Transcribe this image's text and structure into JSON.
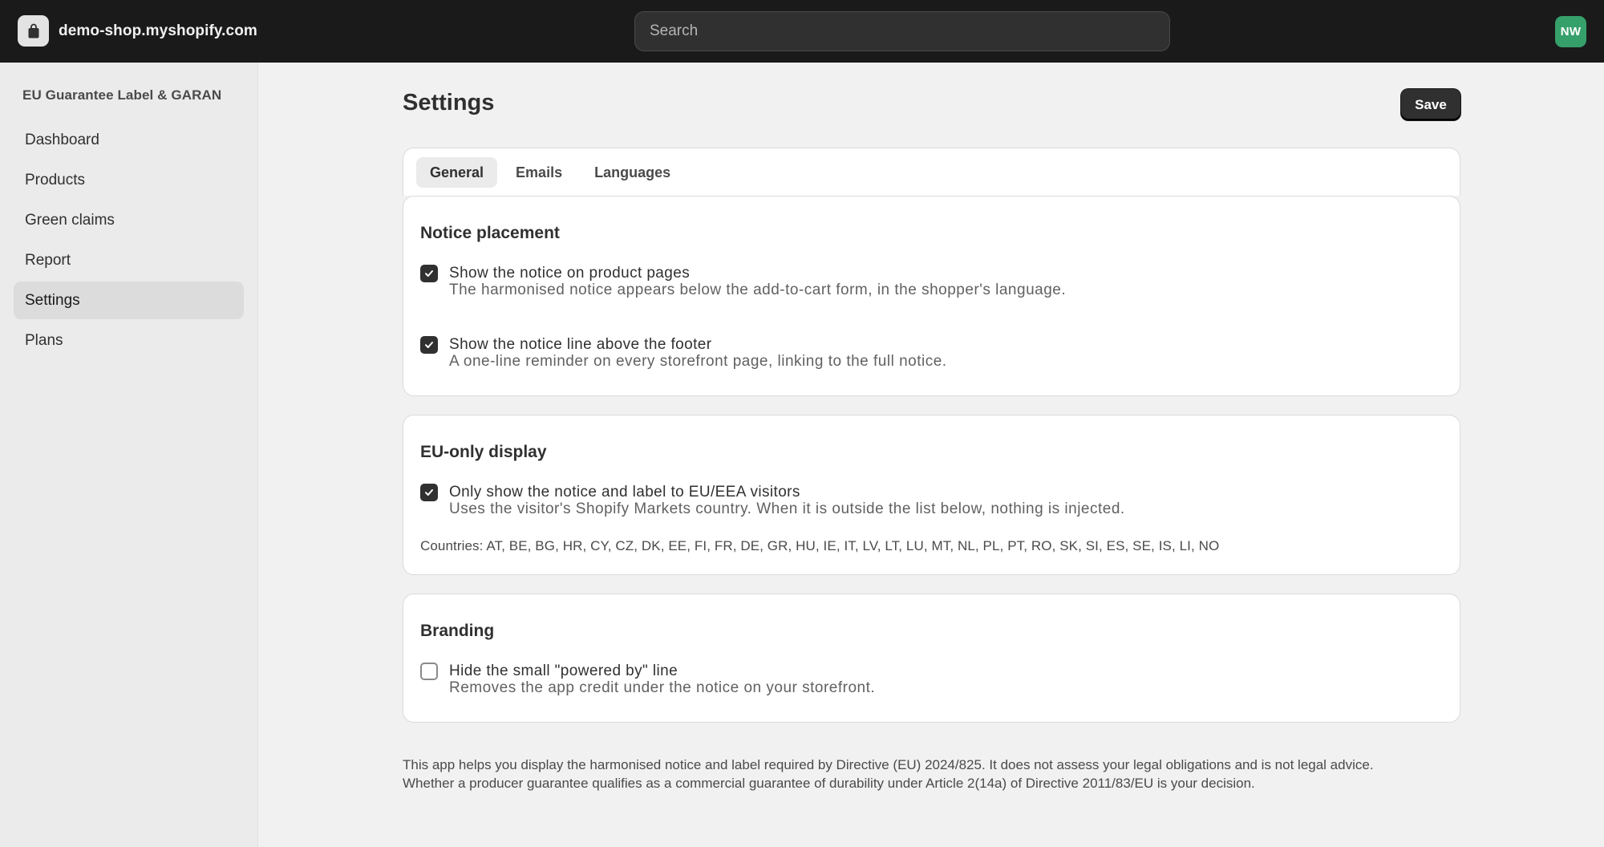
{
  "topbar": {
    "store_name": "demo-shop.myshopify.com",
    "store_icon": "shopping-bag-icon",
    "search_placeholder": "Search",
    "avatar_initials": "NW",
    "avatar_color": "#36a06b"
  },
  "sidebar": {
    "app_name": "EU Guarantee Label & GARAN",
    "items": [
      {
        "label": "Dashboard",
        "active": false
      },
      {
        "label": "Products",
        "active": false
      },
      {
        "label": "Green claims",
        "active": false
      },
      {
        "label": "Report",
        "active": false
      },
      {
        "label": "Settings",
        "active": true
      },
      {
        "label": "Plans",
        "active": false
      }
    ]
  },
  "page": {
    "title": "Settings",
    "save_label": "Save"
  },
  "tabs": [
    {
      "label": "General",
      "active": true
    },
    {
      "label": "Emails",
      "active": false
    },
    {
      "label": "Languages",
      "active": false
    }
  ],
  "sections": {
    "notice_placement": {
      "title": "Notice placement",
      "options": [
        {
          "label": "Show the notice on product pages",
          "help": "The harmonised notice appears below the add-to-cart form, in the shopper's language.",
          "checked": true
        },
        {
          "label": "Show the notice line above the footer",
          "help": "A one-line reminder on every storefront page, linking to the full notice.",
          "checked": true
        }
      ]
    },
    "eu_only": {
      "title": "EU-only display",
      "options": [
        {
          "label": "Only show the notice and label to EU/EEA visitors",
          "help": "Uses the visitor's Shopify Markets country. When it is outside the list below, nothing is injected.",
          "checked": true
        }
      ],
      "countries": "Countries: AT, BE, BG, HR, CY, CZ, DK, EE, FI, FR, DE, GR, HU, IE, IT, LV, LT, LU, MT, NL, PL, PT, RO, SK, SI, ES, SE, IS, LI, NO"
    },
    "branding": {
      "title": "Branding",
      "options": [
        {
          "label": "Hide the small \"powered by\" line",
          "help": "Removes the app credit under the notice on your storefront.",
          "checked": false
        }
      ]
    }
  },
  "footer": {
    "line1": "This app helps you display the harmonised notice and label required by Directive (EU) 2024/825. It does not assess your legal obligations and is not legal advice.",
    "line2": "Whether a producer guarantee qualifies as a commercial guarantee of durability under Article 2(14a) of Directive 2011/83/EU is your decision."
  }
}
